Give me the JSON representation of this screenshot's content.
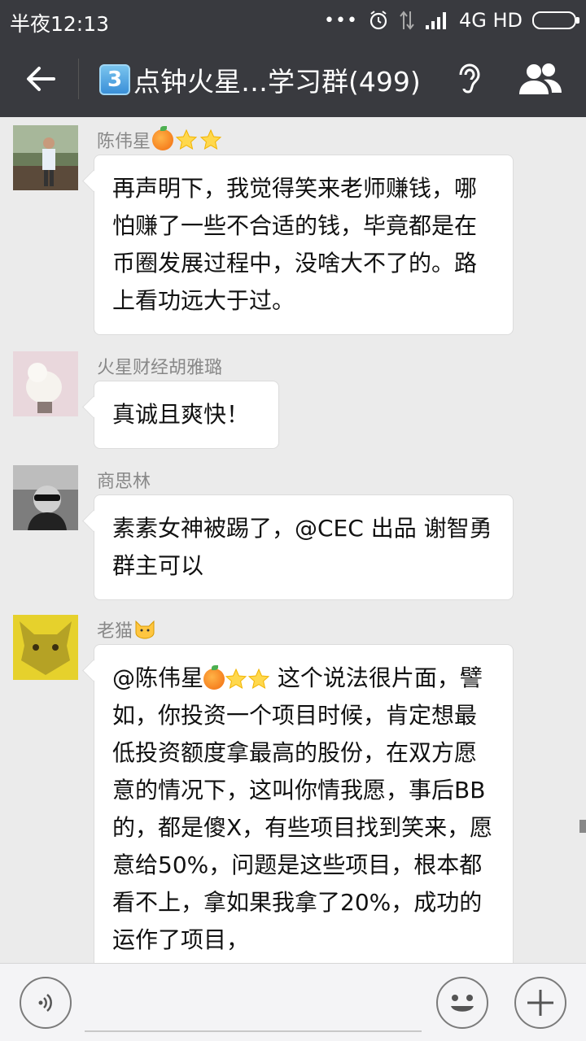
{
  "status_bar": {
    "time": "半夜12:13",
    "dots": "•••",
    "network": "4G HD"
  },
  "header": {
    "badge": "3",
    "title": "点钟火星…学习群(499)"
  },
  "messages": [
    {
      "sender": "陈伟星",
      "text": "再声明下，我觉得笑来老师赚钱，哪怕赚了一些不合适的钱，毕竟都是在币圈发展过程中，没啥大不了的。路上看功远大于过。"
    },
    {
      "sender": "火星财经胡雅璐",
      "text": "真诚且爽快！"
    },
    {
      "sender": "商思林",
      "text": "素素女神被踢了，@CEC 出品 谢智勇 群主可以"
    },
    {
      "sender": "老猫",
      "mention": "@陈伟星",
      "text": "这个说法很片面，譬如，你投资一个项目时候，肯定想最低投资额度拿最高的股份，在双方愿意的情况下，这叫你情我愿，事后BB的，都是傻X，有些项目找到笑来，愿意给50%，问题是这些项目，根本都看不上，拿如果我拿了20%，成功的运作了项目，"
    }
  ],
  "colors": {
    "header_bg": "#393a3f",
    "chat_bg": "#ebebeb",
    "bubble_bg": "#ffffff",
    "sender_text": "#888888"
  },
  "icons": [
    "back-arrow-icon",
    "ear-icon",
    "group-members-icon",
    "voice-icon",
    "emoji-icon",
    "plus-icon",
    "wifi-icon",
    "signal-icon",
    "alarm-icon",
    "battery-icon",
    "orange-emoji",
    "star-emoji",
    "cat-emoji"
  ]
}
